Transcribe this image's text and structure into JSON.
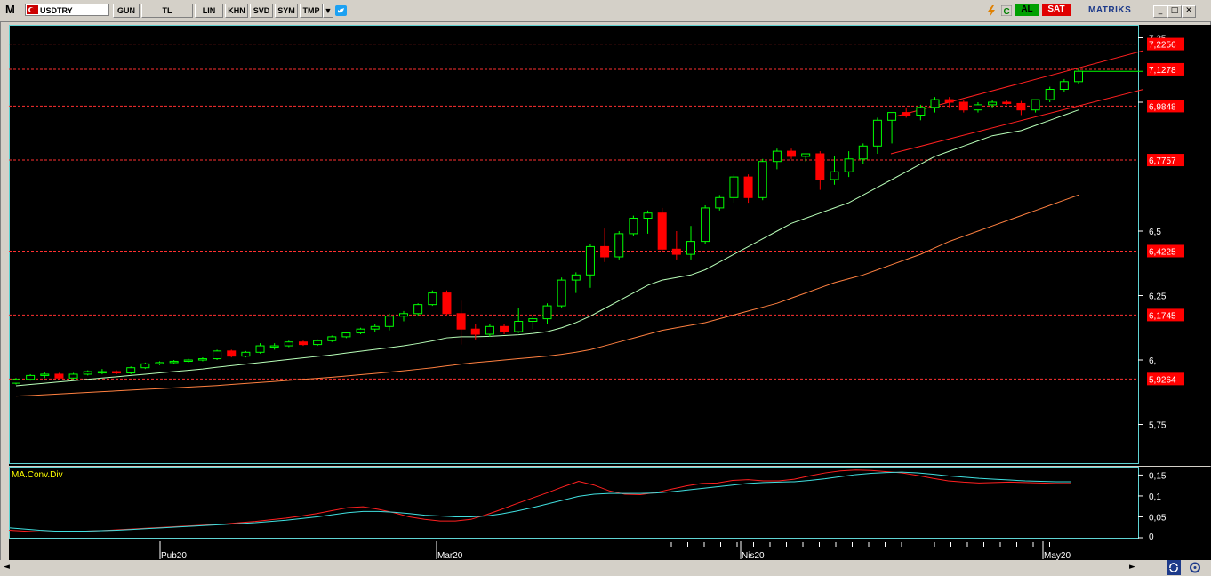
{
  "toolbar": {
    "logo": "M",
    "symbol": "USDTRY",
    "buttons": [
      "GUN",
      "TL",
      "LIN",
      "KHN",
      "SVD",
      "SYM",
      "TMP"
    ],
    "buy_label": "AL",
    "sell_label": "SAT",
    "brand": "MATRIKS",
    "icons": [
      "lightning-icon",
      "refresh-icon",
      "twitter-icon",
      "minimize-icon",
      "maximize-icon",
      "close-icon"
    ]
  },
  "chart_data": [
    {
      "type": "candlestick",
      "series_name": "USDTRY",
      "y_axis_ticks": [
        "7,25",
        "7,",
        "6,5",
        "6,25",
        "6,",
        "5,75"
      ],
      "ylim": [
        5.6,
        7.3
      ],
      "levels": [
        "7,2256",
        "7,1278",
        "6,9848",
        "6,7757",
        "6,4225",
        "6,1745",
        "5,9264"
      ],
      "level_values": [
        7.2256,
        7.1278,
        6.9848,
        6.7757,
        6.4225,
        6.1745,
        5.9264
      ],
      "colors": {
        "up": "#00ff00",
        "down": "#ff0000",
        "ma_fast": "#b8ffb8",
        "ma_slow": "#ff8040",
        "level": "#ff3030",
        "channel": "#ff2020",
        "axis": "#5fd3d3"
      },
      "candles": [
        [
          5.91,
          5.93,
          5.905,
          5.925
        ],
        [
          5.925,
          5.945,
          5.92,
          5.94
        ],
        [
          5.94,
          5.955,
          5.93,
          5.945
        ],
        [
          5.945,
          5.95,
          5.925,
          5.93
        ],
        [
          5.93,
          5.95,
          5.925,
          5.945
        ],
        [
          5.945,
          5.96,
          5.94,
          5.955
        ],
        [
          5.95,
          5.965,
          5.945,
          5.955
        ],
        [
          5.955,
          5.96,
          5.945,
          5.95
        ],
        [
          5.95,
          5.975,
          5.945,
          5.97
        ],
        [
          5.97,
          5.99,
          5.965,
          5.985
        ],
        [
          5.985,
          5.995,
          5.98,
          5.99
        ],
        [
          5.99,
          6.0,
          5.985,
          5.995
        ],
        [
          5.995,
          6.005,
          5.99,
          6.0
        ],
        [
          6.0,
          6.01,
          5.995,
          6.005
        ],
        [
          6.005,
          6.04,
          6.0,
          6.035
        ],
        [
          6.035,
          6.04,
          6.01,
          6.015
        ],
        [
          6.015,
          6.035,
          6.01,
          6.03
        ],
        [
          6.03,
          6.065,
          6.025,
          6.055
        ],
        [
          6.055,
          6.065,
          6.04,
          6.055
        ],
        [
          6.055,
          6.075,
          6.05,
          6.07
        ],
        [
          6.07,
          6.075,
          6.055,
          6.06
        ],
        [
          6.06,
          6.08,
          6.055,
          6.075
        ],
        [
          6.075,
          6.095,
          6.07,
          6.09
        ],
        [
          6.09,
          6.11,
          6.085,
          6.105
        ],
        [
          6.105,
          6.125,
          6.1,
          6.12
        ],
        [
          6.12,
          6.14,
          6.11,
          6.13
        ],
        [
          6.13,
          6.18,
          6.115,
          6.17
        ],
        [
          6.17,
          6.19,
          6.15,
          6.18
        ],
        [
          6.18,
          6.22,
          6.17,
          6.215
        ],
        [
          6.215,
          6.27,
          6.21,
          6.26
        ],
        [
          6.26,
          6.27,
          6.17,
          6.18
        ],
        [
          6.18,
          6.23,
          6.06,
          6.12
        ],
        [
          6.12,
          6.14,
          6.08,
          6.1
        ],
        [
          6.1,
          6.14,
          6.09,
          6.13
        ],
        [
          6.13,
          6.14,
          6.1,
          6.11
        ],
        [
          6.11,
          6.2,
          6.105,
          6.15
        ],
        [
          6.15,
          6.17,
          6.12,
          6.16
        ],
        [
          6.16,
          6.22,
          6.14,
          6.21
        ],
        [
          6.21,
          6.32,
          6.2,
          6.31
        ],
        [
          6.31,
          6.34,
          6.26,
          6.33
        ],
        [
          6.33,
          6.45,
          6.28,
          6.44
        ],
        [
          6.44,
          6.51,
          6.38,
          6.4
        ],
        [
          6.4,
          6.5,
          6.39,
          6.49
        ],
        [
          6.49,
          6.56,
          6.48,
          6.55
        ],
        [
          6.55,
          6.58,
          6.49,
          6.57
        ],
        [
          6.57,
          6.59,
          6.42,
          6.43
        ],
        [
          6.43,
          6.5,
          6.39,
          6.41
        ],
        [
          6.41,
          6.52,
          6.39,
          6.46
        ],
        [
          6.46,
          6.6,
          6.45,
          6.59
        ],
        [
          6.59,
          6.64,
          6.58,
          6.63
        ],
        [
          6.63,
          6.72,
          6.61,
          6.71
        ],
        [
          6.71,
          6.72,
          6.61,
          6.63
        ],
        [
          6.63,
          6.78,
          6.62,
          6.77
        ],
        [
          6.77,
          6.82,
          6.74,
          6.81
        ],
        [
          6.81,
          6.82,
          6.78,
          6.79
        ],
        [
          6.79,
          6.8,
          6.77,
          6.8
        ],
        [
          6.8,
          6.81,
          6.66,
          6.7
        ],
        [
          6.7,
          6.79,
          6.68,
          6.73
        ],
        [
          6.73,
          6.81,
          6.71,
          6.78
        ],
        [
          6.78,
          6.84,
          6.76,
          6.83
        ],
        [
          6.83,
          6.94,
          6.8,
          6.93
        ],
        [
          6.93,
          6.96,
          6.84,
          6.96
        ],
        [
          6.96,
          6.98,
          6.94,
          6.95
        ],
        [
          6.95,
          6.99,
          6.93,
          6.98
        ],
        [
          6.98,
          7.02,
          6.96,
          7.01
        ],
        [
          7.01,
          7.02,
          6.98,
          7.0
        ],
        [
          7.0,
          7.01,
          6.96,
          6.97
        ],
        [
          6.97,
          7.0,
          6.96,
          6.99
        ],
        [
          6.99,
          7.01,
          6.98,
          7.0
        ],
        [
          7.0,
          7.01,
          6.99,
          6.995
        ],
        [
          6.995,
          7.005,
          6.95,
          6.97
        ],
        [
          6.97,
          7.01,
          6.96,
          7.01
        ],
        [
          7.01,
          7.06,
          7.0,
          7.05
        ],
        [
          7.05,
          7.09,
          7.04,
          7.08
        ],
        [
          7.08,
          7.13,
          7.07,
          7.12
        ]
      ],
      "ma_fast": [
        5.9,
        5.905,
        5.91,
        5.915,
        5.92,
        5.925,
        5.93,
        5.935,
        5.94,
        5.945,
        5.95,
        5.955,
        5.96,
        5.965,
        5.972,
        5.978,
        5.984,
        5.99,
        5.996,
        6.002,
        6.008,
        6.014,
        6.02,
        6.027,
        6.034,
        6.041,
        6.048,
        6.055,
        6.064,
        6.074,
        6.086,
        6.09,
        6.09,
        6.092,
        6.095,
        6.098,
        6.103,
        6.11,
        6.125,
        6.145,
        6.17,
        6.2,
        6.23,
        6.26,
        6.29,
        6.31,
        6.32,
        6.33,
        6.35,
        6.38,
        6.41,
        6.44,
        6.47,
        6.5,
        6.53,
        6.55,
        6.57,
        6.59,
        6.61,
        6.64,
        6.67,
        6.7,
        6.73,
        6.76,
        6.79,
        6.81,
        6.83,
        6.85,
        6.87,
        6.88,
        6.89,
        6.91,
        6.93,
        6.95,
        6.97
      ],
      "ma_slow": [
        5.86,
        5.862,
        5.865,
        5.868,
        5.871,
        5.874,
        5.877,
        5.88,
        5.883,
        5.886,
        5.889,
        5.892,
        5.895,
        5.898,
        5.901,
        5.905,
        5.909,
        5.913,
        5.917,
        5.921,
        5.925,
        5.929,
        5.933,
        5.938,
        5.943,
        5.948,
        5.953,
        5.958,
        5.964,
        5.97,
        5.977,
        5.984,
        5.99,
        5.995,
        6.0,
        6.005,
        6.01,
        6.015,
        6.022,
        6.03,
        6.04,
        6.055,
        6.07,
        6.085,
        6.1,
        6.115,
        6.125,
        6.135,
        6.145,
        6.16,
        6.175,
        6.19,
        6.205,
        6.22,
        6.24,
        6.26,
        6.28,
        6.3,
        6.315,
        6.33,
        6.35,
        6.37,
        6.39,
        6.41,
        6.435,
        6.46,
        6.48,
        6.5,
        6.52,
        6.54,
        6.56,
        6.58,
        6.6,
        6.62,
        6.64
      ]
    },
    {
      "type": "line",
      "title": "MA.Conv.Div",
      "y_axis_ticks": [
        "0,15",
        "0,1",
        "0,05",
        "0"
      ],
      "ylim": [
        0,
        0.17
      ],
      "series": [
        {
          "color": "#ff2020",
          "values": [
            0.018,
            0.016,
            0.014,
            0.014,
            0.015,
            0.016,
            0.017,
            0.019,
            0.021,
            0.023,
            0.025,
            0.027,
            0.029,
            0.031,
            0.033,
            0.036,
            0.039,
            0.043,
            0.047,
            0.052,
            0.058,
            0.065,
            0.072,
            0.074,
            0.068,
            0.06,
            0.05,
            0.044,
            0.04,
            0.04,
            0.044,
            0.055,
            0.068,
            0.082,
            0.095,
            0.108,
            0.122,
            0.135,
            0.126,
            0.112,
            0.104,
            0.103,
            0.108,
            0.116,
            0.124,
            0.13,
            0.131,
            0.137,
            0.139,
            0.136,
            0.136,
            0.14,
            0.148,
            0.155,
            0.16,
            0.162,
            0.161,
            0.158,
            0.155,
            0.149,
            0.142,
            0.136,
            0.133,
            0.131,
            0.132,
            0.133,
            0.132,
            0.131,
            0.13,
            0.13
          ]
        },
        {
          "color": "#40e0e0",
          "values": [
            0.024,
            0.021,
            0.018,
            0.016,
            0.016,
            0.016,
            0.017,
            0.018,
            0.02,
            0.022,
            0.024,
            0.026,
            0.028,
            0.03,
            0.032,
            0.034,
            0.036,
            0.039,
            0.042,
            0.046,
            0.05,
            0.055,
            0.06,
            0.063,
            0.063,
            0.061,
            0.058,
            0.054,
            0.052,
            0.05,
            0.05,
            0.052,
            0.057,
            0.064,
            0.072,
            0.081,
            0.09,
            0.099,
            0.104,
            0.106,
            0.106,
            0.106,
            0.107,
            0.11,
            0.114,
            0.118,
            0.122,
            0.126,
            0.13,
            0.132,
            0.133,
            0.134,
            0.137,
            0.141,
            0.146,
            0.151,
            0.154,
            0.156,
            0.157,
            0.155,
            0.152,
            0.148,
            0.145,
            0.142,
            0.14,
            0.138,
            0.136,
            0.135,
            0.134,
            0.134
          ]
        }
      ]
    }
  ],
  "x_axis": {
    "labels": [
      "Pub20",
      "Mar20",
      "Nis20",
      "May20"
    ]
  }
}
